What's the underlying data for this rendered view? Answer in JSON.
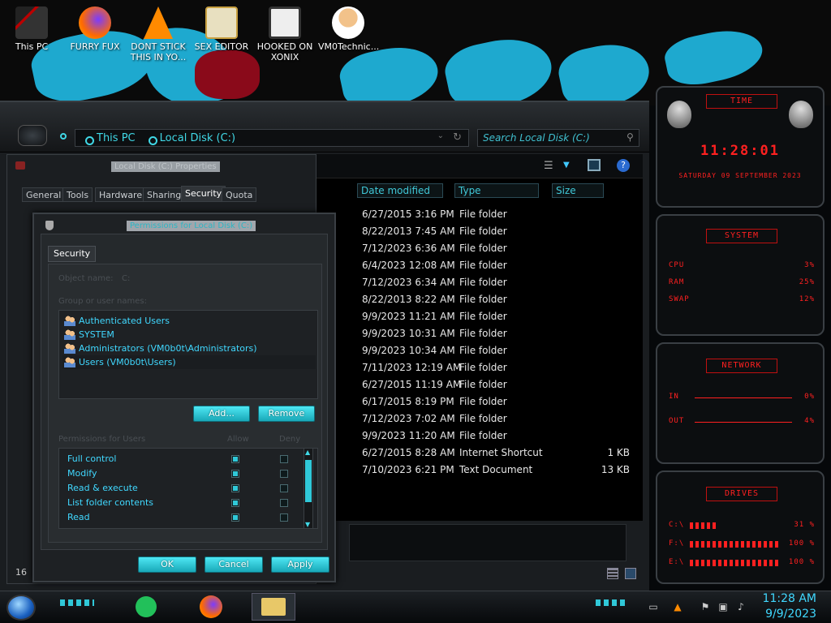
{
  "desktop": {
    "icons": [
      {
        "label": "This PC"
      },
      {
        "label": "FURRY FUX"
      },
      {
        "label": "DONT STICK THIS IN YO..."
      },
      {
        "label": "SEX EDITOR"
      },
      {
        "label": "HOOKED ON XONIX"
      },
      {
        "label": "VM0Technic..."
      }
    ]
  },
  "explorer": {
    "address": [
      "This PC",
      "Local Disk (C:)"
    ],
    "search_placeholder": "Search Local Disk (C:)",
    "columns": [
      "Date modified",
      "Type",
      "Size"
    ],
    "files": [
      {
        "date": "6/27/2015 3:16 PM",
        "type": "File folder",
        "size": ""
      },
      {
        "date": "8/22/2013 7:45 AM",
        "type": "File folder",
        "size": ""
      },
      {
        "date": "7/12/2023 6:36 AM",
        "type": "File folder",
        "size": ""
      },
      {
        "date": "6/4/2023 12:08 AM",
        "type": "File folder",
        "size": ""
      },
      {
        "date": "7/12/2023 6:34 AM",
        "type": "File folder",
        "size": ""
      },
      {
        "date": "8/22/2013 8:22 AM",
        "type": "File folder",
        "size": ""
      },
      {
        "date": "9/9/2023 11:21 AM",
        "type": "File folder",
        "size": ""
      },
      {
        "date": "9/9/2023 10:31 AM",
        "type": "File folder",
        "size": ""
      },
      {
        "date": "9/9/2023 10:34 AM",
        "type": "File folder",
        "size": ""
      },
      {
        "date": "7/11/2023 12:19 AM",
        "type": "File folder",
        "size": ""
      },
      {
        "date": "6/27/2015 11:19 AM",
        "type": "File folder",
        "size": ""
      },
      {
        "date": "6/17/2015 8:19 PM",
        "type": "File folder",
        "size": ""
      },
      {
        "date": "7/12/2023 7:02 AM",
        "type": "File folder",
        "size": ""
      },
      {
        "date": "9/9/2023 11:20 AM",
        "type": "File folder",
        "size": ""
      },
      {
        "date": "6/27/2015 8:28 AM",
        "type": "Internet Shortcut",
        "size": "1 KB"
      },
      {
        "date": "7/10/2023 6:21 PM",
        "type": "Text Document",
        "size": "13 KB"
      }
    ]
  },
  "properties": {
    "title": "Local Disk (C:) Properties",
    "tabs": [
      "General",
      "Tools",
      "Hardware",
      "Sharing",
      "Security",
      "Quota"
    ],
    "active_tab": "Security",
    "side_label": "16"
  },
  "permissions": {
    "title": "Permissions for Local Disk (C:)",
    "tab": "Security",
    "object_name_label": "Object name:",
    "object_name_value": "C:",
    "group_label": "Group or user names:",
    "users": [
      "Authenticated Users",
      "SYSTEM",
      "Administrators (VM0b0t\\Administrators)",
      "Users (VM0b0t\\Users)"
    ],
    "add_label": "Add...",
    "remove_label": "Remove",
    "perm_label": "Permissions for Users",
    "allow_label": "Allow",
    "deny_label": "Deny",
    "perms": [
      {
        "name": "Full control",
        "allow": true,
        "deny": false
      },
      {
        "name": "Modify",
        "allow": true,
        "deny": false
      },
      {
        "name": "Read & execute",
        "allow": true,
        "deny": false
      },
      {
        "name": "List folder contents",
        "allow": true,
        "deny": false
      },
      {
        "name": "Read",
        "allow": true,
        "deny": false
      }
    ],
    "ok_label": "OK",
    "cancel_label": "Cancel",
    "apply_label": "Apply"
  },
  "gadgets": {
    "time_title": "TIME",
    "time_value": "11:28:01",
    "date_value": "SATURDAY 09 SEPTEMBER 2023",
    "system_title": "SYSTEM",
    "system": [
      {
        "label": "CPU",
        "value": "3%"
      },
      {
        "label": "RAM",
        "value": "25%"
      },
      {
        "label": "SWAP",
        "value": "12%"
      }
    ],
    "network_title": "NETWORK",
    "network": [
      {
        "label": "IN",
        "value": "0%"
      },
      {
        "label": "OUT",
        "value": "4%"
      }
    ],
    "drives_title": "DRIVES",
    "drives": [
      {
        "label": "C:\\",
        "value": "31 %",
        "fill": 0.31
      },
      {
        "label": "F:\\",
        "value": "100 %",
        "fill": 1.0
      },
      {
        "label": "E:\\",
        "value": "100 %",
        "fill": 1.0
      }
    ]
  },
  "taskbar": {
    "time": "11:28 AM",
    "date": "9/9/2023"
  }
}
